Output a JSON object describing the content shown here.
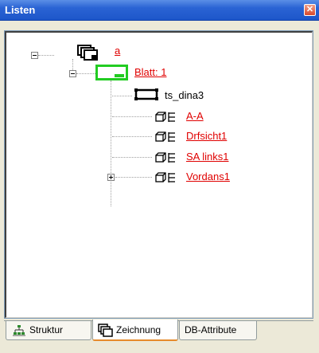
{
  "window": {
    "title": "Listen",
    "close_symbol": "✕"
  },
  "tree": {
    "root": {
      "label": "a"
    },
    "sheet": {
      "label": "Blatt: 1"
    },
    "format": {
      "label": "ts_dina3"
    },
    "views": [
      {
        "label": "A-A"
      },
      {
        "label": "Drfsicht1"
      },
      {
        "label": "SA links1"
      },
      {
        "label": "Vordans1"
      }
    ]
  },
  "tabs": [
    {
      "label": "Struktur",
      "icon": "structure-icon"
    },
    {
      "label": "Zeichnung",
      "icon": "drawing-icon"
    },
    {
      "label": "DB-Attribute"
    }
  ],
  "active_tab": "Zeichnung",
  "colors": {
    "title_bar": "#2a63d4",
    "link_red": "#e00000",
    "sheet_green": "#22cc22",
    "tab_active_accent": "#e68b2c"
  }
}
